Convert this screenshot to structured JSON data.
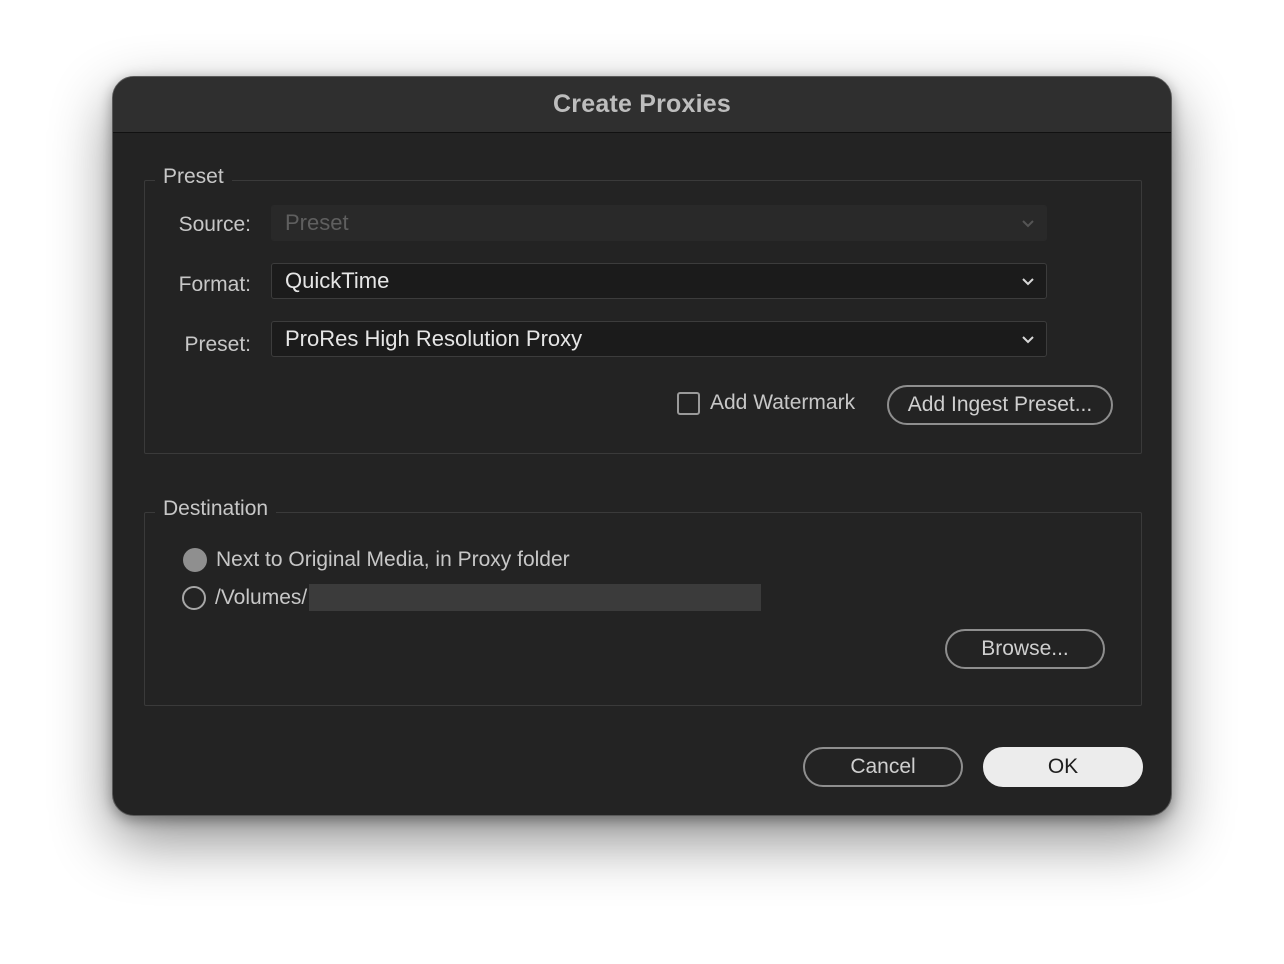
{
  "dialog": {
    "title": "Create Proxies"
  },
  "preset_group": {
    "legend": "Preset",
    "source_label": "Source:",
    "source_value": "Preset",
    "format_label": "Format:",
    "format_value": "QuickTime",
    "preset_label": "Preset:",
    "preset_value": "ProRes High Resolution Proxy",
    "watermark_label": "Add Watermark",
    "watermark_checked": false,
    "add_ingest_label": "Add Ingest Preset..."
  },
  "destination_group": {
    "legend": "Destination",
    "option_original": "Next to Original Media, in Proxy folder",
    "option_path": "/Volumes/",
    "selected_option": "option_original",
    "browse_label": "Browse..."
  },
  "footer": {
    "cancel_label": "Cancel",
    "ok_label": "OK"
  },
  "colors": {
    "dialog_bg": "#232323",
    "titlebar_bg": "#2f2f2f",
    "primary_button_bg": "#ececec"
  }
}
